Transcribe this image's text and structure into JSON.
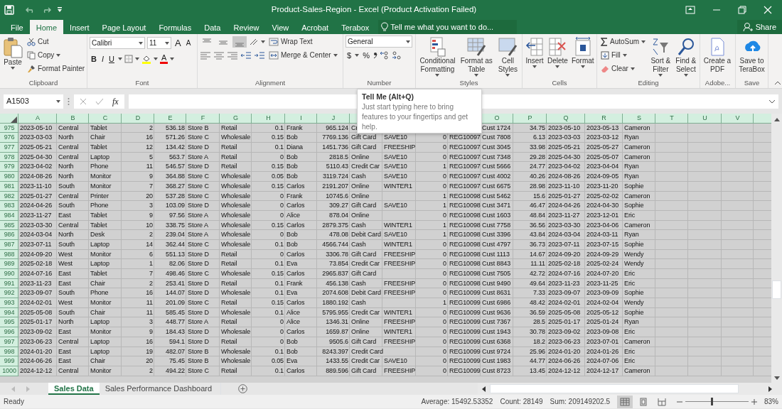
{
  "window": {
    "title": "Product-Sales-Region - Excel (Product Activation Failed)"
  },
  "menu_tabs": [
    {
      "label": "File",
      "selected": false
    },
    {
      "label": "Home",
      "selected": true
    },
    {
      "label": "Insert",
      "selected": false
    },
    {
      "label": "Page Layout",
      "selected": false
    },
    {
      "label": "Formulas",
      "selected": false
    },
    {
      "label": "Data",
      "selected": false
    },
    {
      "label": "Review",
      "selected": false
    },
    {
      "label": "View",
      "selected": false
    },
    {
      "label": "Acrobat",
      "selected": false
    },
    {
      "label": "Terabox",
      "selected": false
    }
  ],
  "tell_me": {
    "placeholder": "Tell me what you want to do..."
  },
  "share": "Share",
  "ribbon": {
    "clipboard": {
      "label": "Clipboard",
      "paste": "Paste",
      "cut": "Cut",
      "copy": "Copy",
      "format_painter": "Format Painter"
    },
    "font": {
      "label": "Font",
      "font_name": "Calibri",
      "font_size": "11",
      "grow": "A",
      "shrink": "A",
      "bold": "B",
      "italic": "I",
      "underline": "U",
      "font_color": "A"
    },
    "alignment": {
      "label": "Alignment",
      "vertical_align": [
        {
          "selected": false
        },
        {
          "selected": false
        },
        {
          "selected": true
        }
      ],
      "wrap_text": "Wrap Text",
      "merge_center": "Merge & Center"
    },
    "number": {
      "label": "Number",
      "format": "General",
      "currency": "$",
      "percent": "%"
    },
    "styles": {
      "label": "Styles",
      "conditional": "Conditional Formatting",
      "format_table": "Format as Table",
      "cell_styles": "Cell Styles"
    },
    "cells": {
      "label": "Cells",
      "insert": "Insert",
      "delete": "Delete",
      "format": "Format"
    },
    "editing": {
      "label": "Editing",
      "autosum": "AutoSum",
      "fill": "Fill",
      "clear": "Clear",
      "sort_filter": "Sort & Filter",
      "find_select": "Find & Select"
    },
    "adobe": {
      "label": "Adobe...",
      "create_pdf": "Create a PDF"
    },
    "save": {
      "label": "Save",
      "save_terabox": "Save to TeraBox"
    }
  },
  "formula_bar": {
    "name_box": "A1503",
    "fx": "fx"
  },
  "tooltip": {
    "title": "Tell Me (Alt+Q)",
    "body": "Just start typing here to bring features to your fingertips and get help."
  },
  "sheet": {
    "all_selected": true,
    "columns": [
      {
        "label": "A",
        "kind": "text"
      },
      {
        "label": "B",
        "kind": "text"
      },
      {
        "label": "C",
        "kind": "text"
      },
      {
        "label": "D",
        "kind": "number"
      },
      {
        "label": "E",
        "kind": "number"
      },
      {
        "label": "F",
        "kind": "text"
      },
      {
        "label": "G",
        "kind": "text"
      },
      {
        "label": "H",
        "kind": "number"
      },
      {
        "label": "I",
        "kind": "text"
      },
      {
        "label": "J",
        "kind": "number"
      },
      {
        "kind": "text"
      },
      {
        "kind": "text"
      },
      {
        "kind": "number"
      },
      {
        "kind": "text"
      },
      {
        "label": "O",
        "kind": "text"
      },
      {
        "label": "P",
        "kind": "number"
      },
      {
        "label": "Q",
        "kind": "text"
      },
      {
        "label": "R",
        "kind": "text"
      },
      {
        "label": "S",
        "kind": "text"
      },
      {
        "label": "T",
        "kind": "text"
      },
      {
        "label": "U",
        "kind": "text"
      },
      {
        "label": "V",
        "kind": "text"
      }
    ],
    "rows": [
      {
        "row": "975",
        "cells": [
          "2023-05-10",
          "Central",
          "Tablet",
          "2",
          "536.18",
          "Store B",
          "Retail",
          "0.1",
          "Frank",
          "965.124",
          "Cr",
          null,
          null,
          null,
          "Cust 1724",
          "34.75",
          "2023-05-10",
          "2023-05-13",
          "Cameron"
        ]
      },
      {
        "row": "976",
        "cells": [
          "2023-03-03",
          "North",
          "Chair",
          "16",
          "571.26",
          "Store C",
          "Wholesale",
          "0.15",
          "Bob",
          "7769.136",
          "Gift Card",
          "SAVE10",
          "0",
          "REG10097",
          "Cust 7808",
          "6.13",
          "2023-03-03",
          "2023-03-12",
          "Ryan"
        ]
      },
      {
        "row": "977",
        "cells": [
          "2025-05-21",
          "Central",
          "Tablet",
          "12",
          "134.42",
          "Store D",
          "Retail",
          "0.1",
          "Diana",
          "1451.736",
          "Gift Card",
          "FREESHIP",
          "0",
          "REG10097",
          "Cust 3045",
          "33.98",
          "2025-05-21",
          "2025-05-27",
          "Cameron"
        ]
      },
      {
        "row": "978",
        "cells": [
          "2025-04-30",
          "Central",
          "Laptop",
          "5",
          "563.7",
          "Store A",
          "Retail",
          "0",
          "Bob",
          "2818.5",
          "Online",
          "SAVE10",
          "0",
          "REG10097",
          "Cust 7348",
          "29.28",
          "2025-04-30",
          "2025-05-07",
          "Cameron"
        ]
      },
      {
        "row": "979",
        "cells": [
          "2023-04-02",
          "North",
          "Phone",
          "11",
          "546.57",
          "Store D",
          "Retail",
          "0.15",
          "Bob",
          "5110.43",
          "Credit Car",
          "SAVE10",
          "1",
          "REG10097",
          "Cust 5666",
          "24.77",
          "2023-04-02",
          "2023-04-04",
          "Ryan"
        ]
      },
      {
        "row": "980",
        "cells": [
          "2024-08-26",
          "North",
          "Monitor",
          "9",
          "364.88",
          "Store C",
          "Wholesale",
          "0.05",
          "Bob",
          "3119.724",
          "Cash",
          "SAVE10",
          "0",
          "REG10097",
          "Cust 4002",
          "40.26",
          "2024-08-26",
          "2024-09-05",
          "Ryan"
        ]
      },
      {
        "row": "981",
        "cells": [
          "2023-11-10",
          "South",
          "Monitor",
          "7",
          "368.27",
          "Store C",
          "Wholesale",
          "0.15",
          "Carlos",
          "2191.207",
          "Online",
          "WINTER1",
          "0",
          "REG10097",
          "Cust 6675",
          "28.98",
          "2023-11-10",
          "2023-11-20",
          "Sophie"
        ]
      },
      {
        "row": "982",
        "cells": [
          "2025-01-27",
          "Central",
          "Printer",
          "20",
          "537.28",
          "Store C",
          "Wholesale",
          "0",
          "Frank",
          "10745.6",
          "Online",
          null,
          "1",
          "REG10098",
          "Cust 5462",
          "15.6",
          "2025-01-27",
          "2025-02-02",
          "Cameron"
        ]
      },
      {
        "row": "983",
        "cells": [
          "2024-04-26",
          "South",
          "Phone",
          "3",
          "103.09",
          "Store D",
          "Wholesale",
          "0",
          "Carlos",
          "309.27",
          "Gift Card",
          "SAVE10",
          "1",
          "REG10098",
          "Cust 3471",
          "46.47",
          "2024-04-26",
          "2024-04-30",
          "Sophie"
        ]
      },
      {
        "row": "984",
        "cells": [
          "2023-11-27",
          "East",
          "Tablet",
          "9",
          "97.56",
          "Store A",
          "Wholesale",
          "0",
          "Alice",
          "878.04",
          "Online",
          null,
          "0",
          "REG10098",
          "Cust 1603",
          "48.84",
          "2023-11-27",
          "2023-12-01",
          "Eric"
        ]
      },
      {
        "row": "985",
        "cells": [
          "2023-03-30",
          "Central",
          "Tablet",
          "10",
          "338.75",
          "Store A",
          "Wholesale",
          "0.15",
          "Carlos",
          "2879.375",
          "Cash",
          "WINTER1",
          "1",
          "REG10098",
          "Cust 7758",
          "36.56",
          "2023-03-30",
          "2023-04-06",
          "Cameron"
        ]
      },
      {
        "row": "986",
        "cells": [
          "2024-03-04",
          "North",
          "Desk",
          "2",
          "239.04",
          "Store A",
          "Wholesale",
          "0",
          "Bob",
          "478.08",
          "Debit Card",
          "SAVE10",
          "1",
          "REG10098",
          "Cust 3396",
          "43.84",
          "2024-03-04",
          "2024-03-11",
          "Ryan"
        ]
      },
      {
        "row": "987",
        "cells": [
          "2023-07-11",
          "South",
          "Laptop",
          "14",
          "362.44",
          "Store C",
          "Wholesale",
          "0.1",
          "Bob",
          "4566.744",
          "Cash",
          "WINTER1",
          "0",
          "REG10098",
          "Cust 4797",
          "36.73",
          "2023-07-11",
          "2023-07-15",
          "Sophie"
        ]
      },
      {
        "row": "988",
        "cells": [
          "2024-09-20",
          "West",
          "Monitor",
          "6",
          "551.13",
          "Store D",
          "Retail",
          "0",
          "Carlos",
          "3306.78",
          "Gift Card",
          "FREESHIP",
          "0",
          "REG10098",
          "Cust 1113",
          "14.67",
          "2024-09-20",
          "2024-09-29",
          "Wendy"
        ]
      },
      {
        "row": "989",
        "cells": [
          "2025-02-18",
          "West",
          "Laptop",
          "1",
          "82.06",
          "Store D",
          "Retail",
          "0.1",
          "Eva",
          "73.854",
          "Credit Car",
          "FREESHIP",
          "0",
          "REG10098",
          "Cust 8843",
          "11.11",
          "2025-02-18",
          "2025-02-24",
          "Wendy"
        ]
      },
      {
        "row": "990",
        "cells": [
          "2024-07-16",
          "East",
          "Tablet",
          "7",
          "498.46",
          "Store C",
          "Wholesale",
          "0.15",
          "Carlos",
          "2965.837",
          "Gift Card",
          null,
          "0",
          "REG10098",
          "Cust 7505",
          "42.72",
          "2024-07-16",
          "2024-07-20",
          "Eric"
        ]
      },
      {
        "row": "991",
        "cells": [
          "2023-11-23",
          "East",
          "Chair",
          "2",
          "253.41",
          "Store D",
          "Retail",
          "0.1",
          "Frank",
          "456.138",
          "Cash",
          "FREESHIP",
          "0",
          "REG10098",
          "Cust 9490",
          "49.64",
          "2023-11-23",
          "2023-11-25",
          "Eric"
        ]
      },
      {
        "row": "992",
        "cells": [
          "2023-09-07",
          "South",
          "Phone",
          "16",
          "144.07",
          "Store D",
          "Wholesale",
          "0.1",
          "Eva",
          "2074.608",
          "Debit Card",
          "FREESHIP",
          "0",
          "REG10099",
          "Cust 8631",
          "7.33",
          "2023-09-07",
          "2023-09-09",
          "Sophie"
        ]
      },
      {
        "row": "993",
        "cells": [
          "2024-02-01",
          "West",
          "Monitor",
          "11",
          "201.09",
          "Store C",
          "Retail",
          "0.15",
          "Carlos",
          "1880.192",
          "Cash",
          null,
          "1",
          "REG10099",
          "Cust 6986",
          "48.42",
          "2024-02-01",
          "2024-02-04",
          "Wendy"
        ]
      },
      {
        "row": "994",
        "cells": [
          "2025-05-08",
          "South",
          "Chair",
          "11",
          "585.45",
          "Store D",
          "Wholesale",
          "0.1",
          "Alice",
          "5795.955",
          "Credit Car",
          "WINTER1",
          "0",
          "REG10099",
          "Cust 9636",
          "36.59",
          "2025-05-08",
          "2025-05-12",
          "Sophie"
        ]
      },
      {
        "row": "995",
        "cells": [
          "2025-01-17",
          "North",
          "Laptop",
          "3",
          "448.77",
          "Store A",
          "Retail",
          "0",
          "Alice",
          "1346.31",
          "Online",
          "FREESHIP",
          "0",
          "REG10099",
          "Cust 7367",
          "28.5",
          "2025-01-17",
          "2025-01-24",
          "Ryan"
        ]
      },
      {
        "row": "996",
        "cells": [
          "2023-09-02",
          "East",
          "Monitor",
          "9",
          "184.43",
          "Store D",
          "Wholesale",
          "0",
          "Carlos",
          "1659.87",
          "Online",
          "WINTER1",
          "0",
          "REG10099",
          "Cust 1943",
          "30.78",
          "2023-09-02",
          "2023-09-08",
          "Eric"
        ]
      },
      {
        "row": "997",
        "cells": [
          "2023-06-23",
          "Central",
          "Laptop",
          "16",
          "594.1",
          "Store D",
          "Retail",
          "0",
          "Bob",
          "9505.6",
          "Gift Card",
          "FREESHIP",
          "0",
          "REG10099",
          "Cust 6368",
          "18.2",
          "2023-06-23",
          "2023-07-01",
          "Cameron"
        ]
      },
      {
        "row": "998",
        "cells": [
          "2024-01-20",
          "East",
          "Laptop",
          "19",
          "482.07",
          "Store B",
          "Wholesale",
          "0.1",
          "Bob",
          "8243.397",
          "Credit Card",
          null,
          "0",
          "REG10099",
          "Cust 9724",
          "25.96",
          "2024-01-20",
          "2024-01-26",
          "Eric"
        ]
      },
      {
        "row": "999",
        "cells": [
          "2024-06-26",
          "East",
          "Chair",
          "20",
          "75.45",
          "Store B",
          "Wholesale",
          "0.05",
          "Eva",
          "1433.55",
          "Credit Car",
          "SAVE10",
          "0",
          "REG10099",
          "Cust 1983",
          "44.77",
          "2024-06-26",
          "2024-07-06",
          "Eric"
        ]
      },
      {
        "row": "1000",
        "cells": [
          "2024-12-12",
          "Central",
          "Monitor",
          "2",
          "494.22",
          "Store C",
          "Retail",
          "0.1",
          "Carlos",
          "889.596",
          "Gift Card",
          "FREESHIP",
          "0",
          "REG10099",
          "Cust 8723",
          "13.45",
          "2024-12-12",
          "2024-12-17",
          "Cameron"
        ]
      }
    ]
  },
  "sheet_tabs": [
    {
      "label": "Sales Data",
      "selected": true
    },
    {
      "label": "Sales Performance Dashboard",
      "selected": false
    }
  ],
  "status_bar": {
    "mode": "Ready",
    "average": "Average: 15492.53352",
    "count": "Count: 28149",
    "sum": "Sum: 209149202.5",
    "views": [
      {
        "selected": true
      },
      {
        "selected": false
      },
      {
        "selected": false
      }
    ],
    "zoom": {
      "level": 0.42,
      "reading": "83%"
    }
  }
}
